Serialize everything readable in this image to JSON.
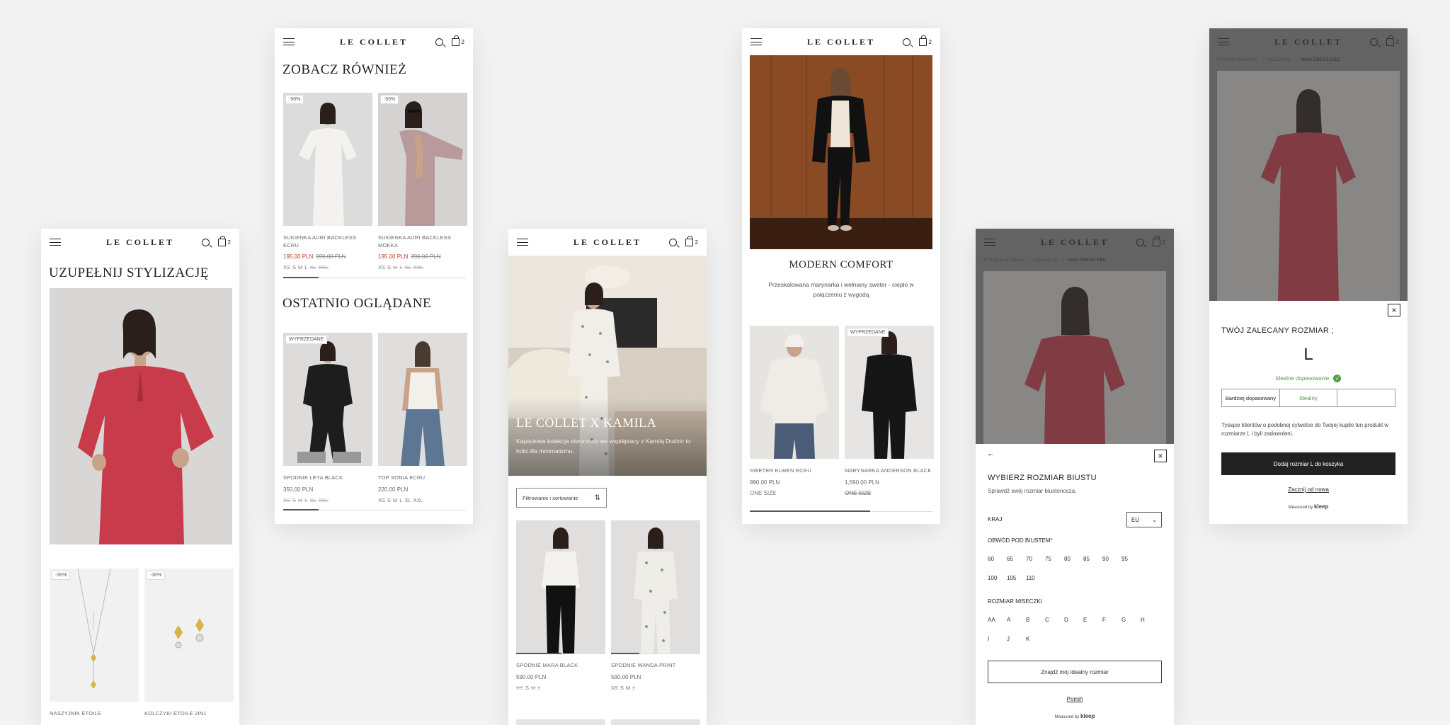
{
  "brand": {
    "logo": "LE COLLET",
    "cart_count": "2"
  },
  "screen1": {
    "title": "UZUPEŁNIJ STYLIZACJĘ",
    "products": [
      {
        "badge": "-30%",
        "name": "NASZYJNIK ETOILE"
      },
      {
        "badge": "-30%",
        "name": "KOLCZYKI ETOILE 2in1"
      }
    ]
  },
  "screen2": {
    "section1_title": "ZOBACZ RÓWNIEŻ",
    "products1": [
      {
        "badge": "-50%",
        "name": "SUKIENKA AURI BACKLESS ECRU",
        "price": "195.00 PLN",
        "old_price": "390.00 PLN",
        "sizes": [
          "XS",
          "S",
          "M",
          "L",
          "XL",
          "XXL"
        ],
        "unavailable": [
          "XL",
          "XXL"
        ]
      },
      {
        "badge": "-50%",
        "name": "SUKIENKA AURI BACKLESS MOKKA",
        "price": "195.00 PLN",
        "old_price": "390.00 PLN",
        "sizes": [
          "XS",
          "S",
          "M",
          "L",
          "XL",
          "XXL"
        ],
        "unavailable": [
          "M",
          "L",
          "XL",
          "XXL"
        ]
      }
    ],
    "section2_title": "OSTATNIO OGLĄDANE",
    "products2": [
      {
        "badge": "WYPRZEDANE",
        "name": "SPODNIE LEYA BLACK",
        "price": "350.00 PLN",
        "sizes": [
          "XS",
          "S",
          "M",
          "L",
          "XL",
          "XXL"
        ],
        "unavailable": [
          "XS",
          "S",
          "M",
          "L",
          "XL",
          "XXL"
        ]
      },
      {
        "badge": "",
        "name": "TOP SONIA ECRU",
        "price": "220.00 PLN",
        "sizes": [
          "XS",
          "S",
          "M",
          "L",
          "XL",
          "XXL"
        ],
        "unavailable": []
      }
    ]
  },
  "screen3": {
    "hero_title": "LE COLLET X KAMILA",
    "hero_text": "Kapsułowa kolekcja stworzona we współpracy z Kamilą Dudzic to hold dla minimalizmu.",
    "filter_label": "Filtrowanie i sortowanie",
    "products": [
      {
        "name": "SPODNIE MARA BLACK",
        "price": "590.00 PLN",
        "sizes": [
          "XS",
          "S",
          "M",
          "L"
        ],
        "unavailable": [
          "XS",
          "M",
          "L"
        ]
      },
      {
        "name": "SPODNIE WANDA PRINT",
        "price": "590.00 PLN",
        "sizes": [
          "XS",
          "S",
          "M",
          "L"
        ],
        "unavailable": [
          "L"
        ]
      }
    ]
  },
  "screen4": {
    "title": "MODERN COMFORT",
    "text": "Przeskalowana marynarka i wełniany sweter - ciepło w połączeniu z wygodą",
    "products": [
      {
        "badge": "",
        "name": "SWETER ELWEN ECRU",
        "price": "990.00 PLN",
        "size": "ONE SIZE",
        "size_unavailable": false
      },
      {
        "badge": "WYPRZEDANE",
        "name": "MARYNARKA ANDERSON BLACK",
        "price": "1,590.00 PLN",
        "size": "ONE SIZE",
        "size_unavailable": true
      }
    ]
  },
  "screen5": {
    "breadcrumb": [
      "STRONA GŁÓWNA",
      "KOLEKCJE",
      "NINA DRESS RED"
    ],
    "sheet_title": "WYBIERZ ROZMIAR BIUSTU",
    "sheet_subtitle": "Sprawdź swój rozmiar biustonosza.",
    "country_label": "KRAJ",
    "country_value": "EU",
    "band_label": "OBWÓD POD BIUSTEM*",
    "bands": [
      "60",
      "65",
      "70",
      "75",
      "80",
      "85",
      "90",
      "95",
      "100",
      "105",
      "110"
    ],
    "cup_label": "ROZMIAR MISECZKI",
    "cups": [
      "AA",
      "A",
      "B",
      "C",
      "D",
      "E",
      "F",
      "G",
      "H",
      "I",
      "J",
      "K"
    ],
    "find_button": "Znajdź mój idealny rozmiar",
    "skip_link": "Pomiń",
    "measured_by": "Measured by",
    "kleep": "kleep"
  },
  "screen6": {
    "breadcrumb": [
      "STRONA GŁÓWNA",
      "KOLEKCJE",
      "NINA DRESS RED"
    ],
    "rec_title": "TWÓJ ZALECANY ROZMIAR ;",
    "rec_size": "L",
    "fit_label": "Idealne dopasowanie",
    "fit_options": [
      "Bardziej dopasowany",
      "Idealny",
      ""
    ],
    "fit_text": "Tysiące klientów o podobnej sylwetce do Twojej kupiło ten produkt w rozmiarze L i byli zadowoleni.",
    "add_button": "Dodaj rozmiar L do koszyka",
    "restart_link": "Zacznij od nowa",
    "measured_by": "Measured by",
    "kleep": "kleep"
  },
  "colors": {
    "red_dress": "#c73b4a",
    "sale_red": "#c0392b",
    "fit_green": "#5a9a4a",
    "dark": "#222222"
  }
}
